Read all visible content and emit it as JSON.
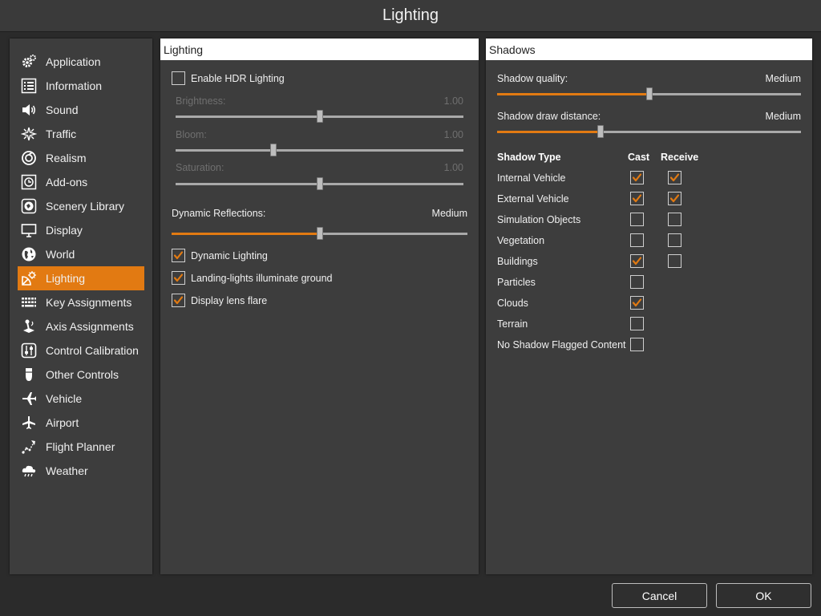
{
  "window": {
    "title": "Lighting"
  },
  "colors": {
    "accent": "#e27a12",
    "panel": "#3d3d3d",
    "background": "#2b2b2b"
  },
  "sidebar": {
    "items": [
      {
        "label": "Application",
        "icon": "gears-icon"
      },
      {
        "label": "Information",
        "icon": "list-icon"
      },
      {
        "label": "Sound",
        "icon": "speaker-icon"
      },
      {
        "label": "Traffic",
        "icon": "traffic-icon"
      },
      {
        "label": "Realism",
        "icon": "realism-icon"
      },
      {
        "label": "Add-ons",
        "icon": "addons-icon"
      },
      {
        "label": "Scenery Library",
        "icon": "scenery-icon"
      },
      {
        "label": "Display",
        "icon": "monitor-icon"
      },
      {
        "label": "World",
        "icon": "globe-icon"
      },
      {
        "label": "Lighting",
        "icon": "lighting-icon",
        "active": true
      },
      {
        "label": "Key Assignments",
        "icon": "keyboard-icon"
      },
      {
        "label": "Axis Assignments",
        "icon": "joystick-icon"
      },
      {
        "label": "Control Calibration",
        "icon": "calibration-icon"
      },
      {
        "label": "Other Controls",
        "icon": "controller-icon"
      },
      {
        "label": "Vehicle",
        "icon": "airplane-icon"
      },
      {
        "label": "Airport",
        "icon": "airport-icon"
      },
      {
        "label": "Flight Planner",
        "icon": "flight-planner-icon"
      },
      {
        "label": "Weather",
        "icon": "weather-icon"
      }
    ]
  },
  "lighting": {
    "header": "Lighting",
    "hdr": {
      "label": "Enable HDR Lighting",
      "checked": false
    },
    "brightness": {
      "label": "Brightness:",
      "value": "1.00",
      "level": 0.5,
      "enabled": false
    },
    "bloom": {
      "label": "Bloom:",
      "value": "1.00",
      "level": 0.34,
      "enabled": false
    },
    "saturation": {
      "label": "Saturation:",
      "value": "1.00",
      "level": 0.5,
      "enabled": false
    },
    "reflections": {
      "label": "Dynamic Reflections:",
      "value": "Medium",
      "level": 0.5,
      "enabled": true
    },
    "dynamic_lighting": {
      "label": "Dynamic Lighting",
      "checked": true
    },
    "landing_lights": {
      "label": "Landing-lights illuminate ground",
      "checked": true
    },
    "lens_flare": {
      "label": "Display lens flare",
      "checked": true
    }
  },
  "shadows": {
    "header": "Shadows",
    "quality": {
      "label": "Shadow quality:",
      "value": "Medium",
      "level": 0.5
    },
    "distance": {
      "label": "Shadow draw distance:",
      "value": "Medium",
      "level": 0.34
    },
    "table": {
      "col_type": "Shadow Type",
      "col_cast": "Cast",
      "col_receive": "Receive",
      "rows": [
        {
          "label": "Internal Vehicle",
          "cast": true,
          "receive": true
        },
        {
          "label": "External Vehicle",
          "cast": true,
          "receive": true
        },
        {
          "label": "Simulation Objects",
          "cast": false,
          "receive": false
        },
        {
          "label": "Vegetation",
          "cast": false,
          "receive": false
        },
        {
          "label": "Buildings",
          "cast": true,
          "receive": false
        },
        {
          "label": "Particles",
          "cast": false
        },
        {
          "label": "Clouds",
          "cast": true
        },
        {
          "label": "Terrain",
          "cast": false
        },
        {
          "label": "No Shadow Flagged Content",
          "cast": false
        }
      ]
    }
  },
  "footer": {
    "cancel": "Cancel",
    "ok": "OK"
  }
}
